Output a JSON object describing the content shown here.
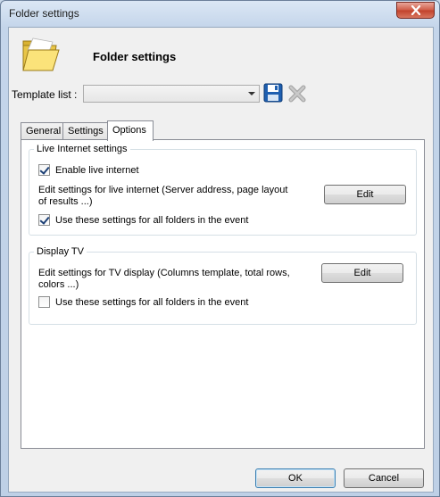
{
  "window": {
    "title": "Folder settings"
  },
  "header": {
    "title": "Folder settings"
  },
  "template": {
    "label": "Template list :",
    "selected": ""
  },
  "tabs": [
    {
      "label": "General"
    },
    {
      "label": "Settings"
    },
    {
      "label": "Options"
    }
  ],
  "live_internet": {
    "legend": "Live Internet settings",
    "enable_label": "Enable live internet",
    "enable_checked": true,
    "description": "Edit settings for live internet (Server address, page layout of results ...)",
    "edit_label": "Edit",
    "apply_all_label": "Use these settings for all folders in the event",
    "apply_all_checked": true
  },
  "display_tv": {
    "legend": "Display TV",
    "description": "Edit settings for TV display (Columns template, total rows, colors ...)",
    "edit_label": "Edit",
    "apply_all_label": "Use these settings for all folders in the event",
    "apply_all_checked": false
  },
  "footer": {
    "ok_label": "OK",
    "cancel_label": "Cancel"
  }
}
